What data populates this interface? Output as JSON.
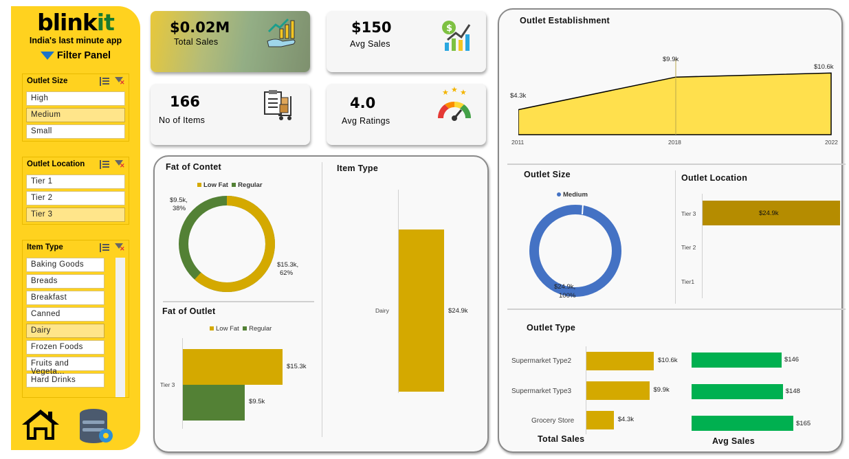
{
  "brand": {
    "logo_main": "blink",
    "logo_accent": "it",
    "tagline": "India's last minute app",
    "filter_title": "Filter Panel"
  },
  "colors": {
    "brand_yellow": "#ffd21f",
    "gold": "#d4a900",
    "dark_gold": "#b58c00",
    "green": "#538135",
    "blue": "#4472c4",
    "avg_green": "#00b050",
    "area_fill": "#ffe04d"
  },
  "slicers": {
    "outlet_size": {
      "title": "Outlet Size",
      "items": [
        {
          "label": "High",
          "selected": false
        },
        {
          "label": "Medium",
          "selected": true
        },
        {
          "label": "Small",
          "selected": false
        }
      ]
    },
    "outlet_location": {
      "title": "Outlet Location",
      "items": [
        {
          "label": "Tier 1",
          "selected": false
        },
        {
          "label": "Tier 2",
          "selected": false
        },
        {
          "label": "Tier 3",
          "selected": true
        }
      ]
    },
    "item_type": {
      "title": "Item Type",
      "items": [
        {
          "label": "Baking Goods",
          "selected": false
        },
        {
          "label": "Breads",
          "selected": false
        },
        {
          "label": "Breakfast",
          "selected": false
        },
        {
          "label": "Canned",
          "selected": false
        },
        {
          "label": "Dairy",
          "selected": true
        },
        {
          "label": "Frozen Foods",
          "selected": false
        },
        {
          "label": "Fruits and Vegeta...",
          "selected": false
        },
        {
          "label": "Hard Drinks",
          "selected": false
        }
      ]
    }
  },
  "nav_icons": {
    "home": "home-icon",
    "database": "database-settings-icon"
  },
  "kpis": {
    "total_sales": {
      "value": "$0.02M",
      "label": "Total Sales",
      "icon": "growth-hand-icon"
    },
    "avg_sales": {
      "value": "$150",
      "label": "Avg Sales",
      "icon": "money-chart-icon"
    },
    "items": {
      "value": "166",
      "label": "No of Items",
      "icon": "clipboard-cart-icon"
    },
    "rating": {
      "value": "4.0",
      "label": "Avg Ratings",
      "icon": "rating-gauge-icon"
    }
  },
  "chart_data": [
    {
      "id": "fat_content",
      "type": "pie",
      "title": "Fat of Contet",
      "legend_position": "top",
      "series": [
        {
          "name": "Low Fat",
          "value": 15.3,
          "label": "$15.3k,",
          "pct": "62%",
          "color": "#d4a900"
        },
        {
          "name": "Regular",
          "value": 9.5,
          "label": "$9.5k,",
          "pct": "38%",
          "color": "#538135"
        }
      ]
    },
    {
      "id": "fat_outlet",
      "type": "bar",
      "title": "Fat of Outlet",
      "orientation": "horizontal",
      "legend_position": "top",
      "categories": [
        "Tier 3"
      ],
      "series": [
        {
          "name": "Low Fat",
          "values": [
            15.3
          ],
          "labels": [
            "$15.3k"
          ],
          "color": "#d4a900"
        },
        {
          "name": "Regular",
          "values": [
            9.5
          ],
          "labels": [
            "$9.5k"
          ],
          "color": "#538135"
        }
      ]
    },
    {
      "id": "item_type",
      "type": "bar",
      "title": "Item Type",
      "orientation": "horizontal",
      "categories": [
        "Dairy"
      ],
      "values": [
        24.9
      ],
      "labels": [
        "$24.9k"
      ],
      "color": "#d4a900"
    },
    {
      "id": "outlet_establishment",
      "type": "area",
      "title": "Outlet Establishment",
      "x": [
        "2011",
        "2018",
        "2022"
      ],
      "values": [
        4.3,
        9.9,
        10.6
      ],
      "labels": [
        "$4.3k",
        "$9.9k",
        "$10.6k"
      ],
      "color": "#ffe04d"
    },
    {
      "id": "outlet_size",
      "type": "pie",
      "title": "Outlet Size",
      "legend_position": "top",
      "series": [
        {
          "name": "Medium",
          "value": 24.9,
          "label": "$24.9k,",
          "pct": "100%",
          "color": "#4472c4"
        }
      ]
    },
    {
      "id": "outlet_location",
      "type": "bar",
      "title": "Outlet Location",
      "orientation": "horizontal",
      "categories": [
        "Tier 3",
        "Tier 2",
        "Tier1"
      ],
      "values": [
        24.9,
        0,
        0
      ],
      "labels": [
        "$24.9k",
        "",
        ""
      ],
      "color": "#b58c00"
    },
    {
      "id": "outlet_type_sales",
      "type": "bar",
      "title": "Outlet Type",
      "xlabel": "Total Sales",
      "orientation": "horizontal",
      "categories": [
        "Supermarket Type2",
        "Supermarket Type3",
        "Grocery Store"
      ],
      "values": [
        10.6,
        9.9,
        4.3
      ],
      "labels": [
        "$10.6k",
        "$9.9k",
        "$4.3k"
      ],
      "color": "#d4a900"
    },
    {
      "id": "outlet_type_avg",
      "type": "bar",
      "xlabel": "Avg Sales",
      "orientation": "horizontal",
      "categories": [
        "Supermarket Type2",
        "Supermarket Type3",
        "Grocery Store"
      ],
      "values": [
        146,
        148,
        165
      ],
      "labels": [
        "$146",
        "$148",
        "$165"
      ],
      "color": "#00b050"
    }
  ]
}
